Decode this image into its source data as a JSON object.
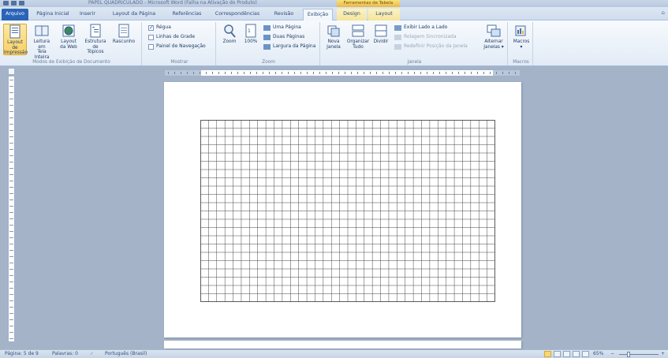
{
  "window": {
    "title": "PAPEL QUADRICULADO - Microsoft Word (Falha na Ativação do Produto)",
    "context_tool": "Ferramentas de Tabela"
  },
  "tabs": [
    {
      "label": "Arquivo"
    },
    {
      "label": "Página Inicial"
    },
    {
      "label": "Inserir"
    },
    {
      "label": "Layout da Página"
    },
    {
      "label": "Referências"
    },
    {
      "label": "Correspondências"
    },
    {
      "label": "Revisão"
    },
    {
      "label": "Exibição"
    },
    {
      "label": "Design"
    },
    {
      "label": "Layout"
    }
  ],
  "ribbon": {
    "views_group": {
      "label": "Modos de Exibição de Documento",
      "print_layout_line1": "Layout de",
      "print_layout_line2": "Impressão",
      "full_screen_line1": "Leitura em",
      "full_screen_line2": "Tela Inteira",
      "web_layout_line1": "Layout",
      "web_layout_line2": "da Web",
      "outline_line1": "Estrutura",
      "outline_line2": "de Tópicos",
      "draft_line1": "Rascunho",
      "draft_line2": ""
    },
    "show_group": {
      "label": "Mostrar",
      "ruler": "Régua",
      "gridlines": "Linhas de Grade",
      "nav_pane": "Painel de Navegação"
    },
    "zoom_group": {
      "label": "Zoom",
      "zoom": "Zoom",
      "percent100": "100%",
      "one_page": "Uma Página",
      "two_pages": "Duas Páginas",
      "page_width": "Largura da Página"
    },
    "window_group": {
      "label": "Janela",
      "new_window_line1": "Nova",
      "new_window_line2": "Janela",
      "arrange_line1": "Organizar",
      "arrange_line2": "Tudo",
      "split": "Dividir",
      "side_by_side": "Exibir Lado a Lado",
      "sync_scroll": "Rolagem Sincronizada",
      "reset_pos": "Redefinir Posição da Janela",
      "switch_line1": "Alternar",
      "switch_line2": "Janelas ▾"
    },
    "macros_group": {
      "label": "Macros",
      "macros": "Macros",
      "macros_arrow": "▾"
    }
  },
  "status": {
    "page": "Página: 5 de 9",
    "words": "Palavras: 0",
    "language": "Português (Brasil)",
    "zoom": "65%",
    "minus": "−",
    "plus": "+"
  },
  "colors": {
    "file_tab": "#2a64b8",
    "selected_button": "#f8cf62",
    "background": "#a4b3c8"
  }
}
